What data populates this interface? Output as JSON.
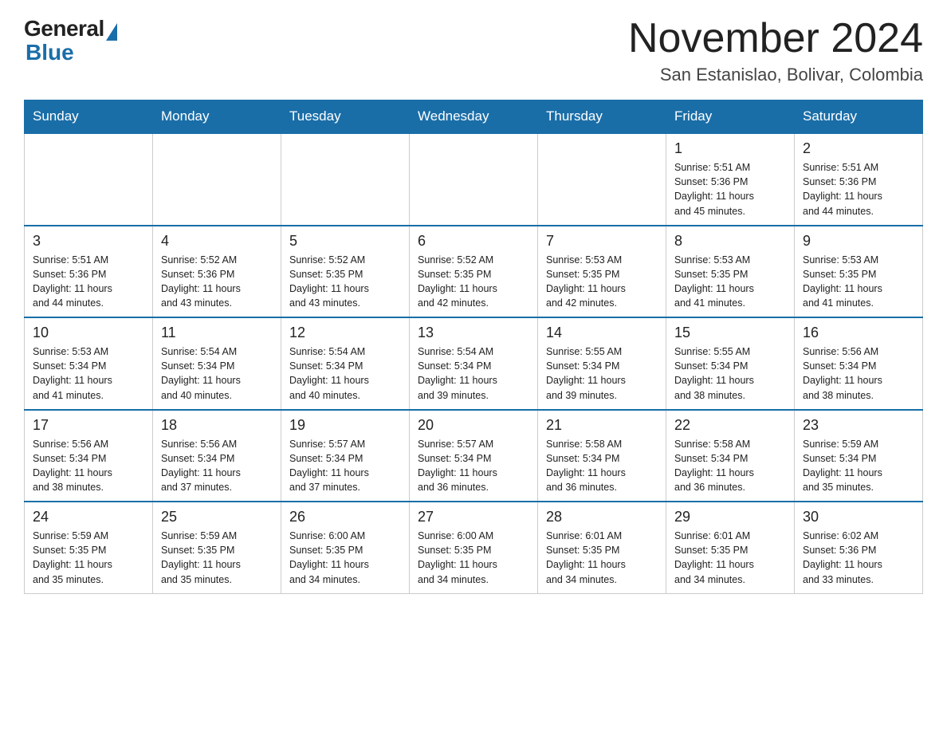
{
  "header": {
    "logo_general": "General",
    "logo_blue": "Blue",
    "month_title": "November 2024",
    "subtitle": "San Estanislao, Bolivar, Colombia"
  },
  "weekdays": [
    "Sunday",
    "Monday",
    "Tuesday",
    "Wednesday",
    "Thursday",
    "Friday",
    "Saturday"
  ],
  "weeks": [
    [
      {
        "day": "",
        "info": ""
      },
      {
        "day": "",
        "info": ""
      },
      {
        "day": "",
        "info": ""
      },
      {
        "day": "",
        "info": ""
      },
      {
        "day": "",
        "info": ""
      },
      {
        "day": "1",
        "info": "Sunrise: 5:51 AM\nSunset: 5:36 PM\nDaylight: 11 hours\nand 45 minutes."
      },
      {
        "day": "2",
        "info": "Sunrise: 5:51 AM\nSunset: 5:36 PM\nDaylight: 11 hours\nand 44 minutes."
      }
    ],
    [
      {
        "day": "3",
        "info": "Sunrise: 5:51 AM\nSunset: 5:36 PM\nDaylight: 11 hours\nand 44 minutes."
      },
      {
        "day": "4",
        "info": "Sunrise: 5:52 AM\nSunset: 5:36 PM\nDaylight: 11 hours\nand 43 minutes."
      },
      {
        "day": "5",
        "info": "Sunrise: 5:52 AM\nSunset: 5:35 PM\nDaylight: 11 hours\nand 43 minutes."
      },
      {
        "day": "6",
        "info": "Sunrise: 5:52 AM\nSunset: 5:35 PM\nDaylight: 11 hours\nand 42 minutes."
      },
      {
        "day": "7",
        "info": "Sunrise: 5:53 AM\nSunset: 5:35 PM\nDaylight: 11 hours\nand 42 minutes."
      },
      {
        "day": "8",
        "info": "Sunrise: 5:53 AM\nSunset: 5:35 PM\nDaylight: 11 hours\nand 41 minutes."
      },
      {
        "day": "9",
        "info": "Sunrise: 5:53 AM\nSunset: 5:35 PM\nDaylight: 11 hours\nand 41 minutes."
      }
    ],
    [
      {
        "day": "10",
        "info": "Sunrise: 5:53 AM\nSunset: 5:34 PM\nDaylight: 11 hours\nand 41 minutes."
      },
      {
        "day": "11",
        "info": "Sunrise: 5:54 AM\nSunset: 5:34 PM\nDaylight: 11 hours\nand 40 minutes."
      },
      {
        "day": "12",
        "info": "Sunrise: 5:54 AM\nSunset: 5:34 PM\nDaylight: 11 hours\nand 40 minutes."
      },
      {
        "day": "13",
        "info": "Sunrise: 5:54 AM\nSunset: 5:34 PM\nDaylight: 11 hours\nand 39 minutes."
      },
      {
        "day": "14",
        "info": "Sunrise: 5:55 AM\nSunset: 5:34 PM\nDaylight: 11 hours\nand 39 minutes."
      },
      {
        "day": "15",
        "info": "Sunrise: 5:55 AM\nSunset: 5:34 PM\nDaylight: 11 hours\nand 38 minutes."
      },
      {
        "day": "16",
        "info": "Sunrise: 5:56 AM\nSunset: 5:34 PM\nDaylight: 11 hours\nand 38 minutes."
      }
    ],
    [
      {
        "day": "17",
        "info": "Sunrise: 5:56 AM\nSunset: 5:34 PM\nDaylight: 11 hours\nand 38 minutes."
      },
      {
        "day": "18",
        "info": "Sunrise: 5:56 AM\nSunset: 5:34 PM\nDaylight: 11 hours\nand 37 minutes."
      },
      {
        "day": "19",
        "info": "Sunrise: 5:57 AM\nSunset: 5:34 PM\nDaylight: 11 hours\nand 37 minutes."
      },
      {
        "day": "20",
        "info": "Sunrise: 5:57 AM\nSunset: 5:34 PM\nDaylight: 11 hours\nand 36 minutes."
      },
      {
        "day": "21",
        "info": "Sunrise: 5:58 AM\nSunset: 5:34 PM\nDaylight: 11 hours\nand 36 minutes."
      },
      {
        "day": "22",
        "info": "Sunrise: 5:58 AM\nSunset: 5:34 PM\nDaylight: 11 hours\nand 36 minutes."
      },
      {
        "day": "23",
        "info": "Sunrise: 5:59 AM\nSunset: 5:34 PM\nDaylight: 11 hours\nand 35 minutes."
      }
    ],
    [
      {
        "day": "24",
        "info": "Sunrise: 5:59 AM\nSunset: 5:35 PM\nDaylight: 11 hours\nand 35 minutes."
      },
      {
        "day": "25",
        "info": "Sunrise: 5:59 AM\nSunset: 5:35 PM\nDaylight: 11 hours\nand 35 minutes."
      },
      {
        "day": "26",
        "info": "Sunrise: 6:00 AM\nSunset: 5:35 PM\nDaylight: 11 hours\nand 34 minutes."
      },
      {
        "day": "27",
        "info": "Sunrise: 6:00 AM\nSunset: 5:35 PM\nDaylight: 11 hours\nand 34 minutes."
      },
      {
        "day": "28",
        "info": "Sunrise: 6:01 AM\nSunset: 5:35 PM\nDaylight: 11 hours\nand 34 minutes."
      },
      {
        "day": "29",
        "info": "Sunrise: 6:01 AM\nSunset: 5:35 PM\nDaylight: 11 hours\nand 34 minutes."
      },
      {
        "day": "30",
        "info": "Sunrise: 6:02 AM\nSunset: 5:36 PM\nDaylight: 11 hours\nand 33 minutes."
      }
    ]
  ]
}
